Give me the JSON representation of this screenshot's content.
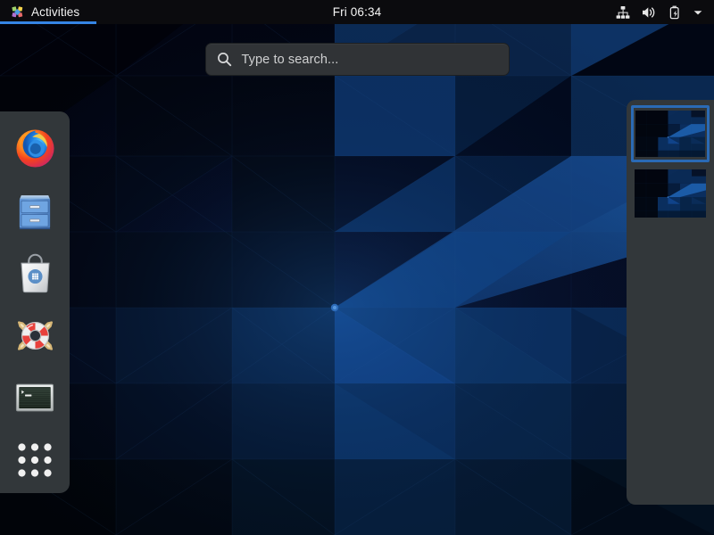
{
  "desktop": {
    "wallpaper_name": "adwaita-geometric-dark",
    "colors": {
      "wallpaper_dark": "#02040f",
      "wallpaper_mid": "#0a1b3d",
      "wallpaper_light": "#17467f",
      "panel_bg": "#0b0b0e",
      "dash_bg": "#32373a",
      "accent_blue": "#3584e4",
      "workspace_selected_border": "#2a6ab5",
      "search_bg": "#303336",
      "text_primary": "#f2f2f2"
    }
  },
  "topbar": {
    "activities": {
      "label": "Activities",
      "icon": "gnome-pinwheel-icon",
      "active": true
    },
    "clock": {
      "label": "Fri 06:34"
    },
    "status": {
      "icons": [
        {
          "name": "wired-network-icon",
          "label": "Wired Network"
        },
        {
          "name": "volume-icon",
          "label": "Volume"
        },
        {
          "name": "battery-charging-icon",
          "label": "Battery Charging"
        },
        {
          "name": "chevron-down-icon",
          "label": "System Menu"
        }
      ]
    }
  },
  "search": {
    "placeholder": "Type to search...",
    "value": "",
    "icon": "search-icon"
  },
  "dash": {
    "items": [
      {
        "name": "dash-item-firefox",
        "icon": "firefox-icon",
        "label": "Firefox Web Browser"
      },
      {
        "name": "dash-item-files",
        "icon": "file-cabinet-icon",
        "label": "Files"
      },
      {
        "name": "dash-item-software",
        "icon": "shopping-bag-icon",
        "label": "Software"
      },
      {
        "name": "dash-item-help",
        "icon": "lifebuoy-icon",
        "label": "Help"
      },
      {
        "name": "dash-item-terminal",
        "icon": "terminal-icon",
        "label": "Terminal"
      },
      {
        "name": "dash-item-show-apps",
        "icon": "app-grid-icon",
        "label": "Show Applications"
      }
    ]
  },
  "workspaces": {
    "thumbnails": [
      {
        "name": "workspace-thumbnail-1",
        "label": "Workspace 1",
        "selected": true
      },
      {
        "name": "workspace-thumbnail-2",
        "label": "Workspace 2",
        "selected": false
      }
    ]
  }
}
